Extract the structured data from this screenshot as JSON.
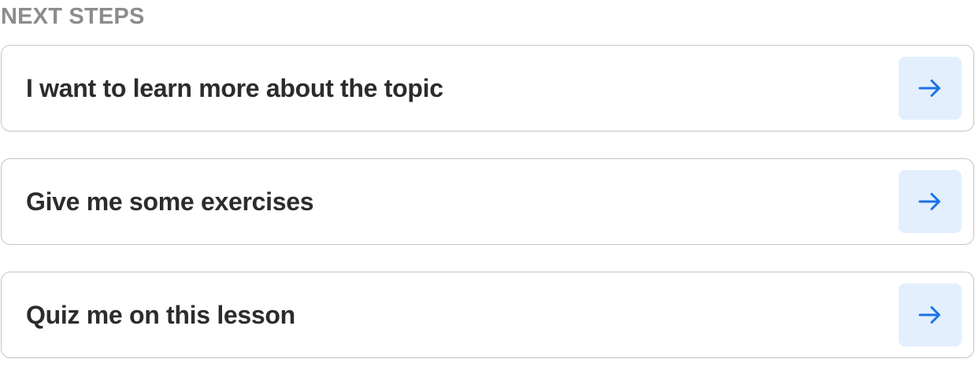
{
  "section": {
    "title": "NEXT STEPS"
  },
  "steps": [
    {
      "label": "I want to learn more about the topic",
      "icon": "arrow-right-icon"
    },
    {
      "label": "Give me some exercises",
      "icon": "arrow-right-icon"
    },
    {
      "label": "Quiz me on this lesson",
      "icon": "arrow-right-icon"
    }
  ],
  "colors": {
    "title": "#8c8c8c",
    "label": "#2c2c2c",
    "card_border": "#c4c4c4",
    "button_bg": "#e3effd",
    "accent": "#1a73e8"
  }
}
